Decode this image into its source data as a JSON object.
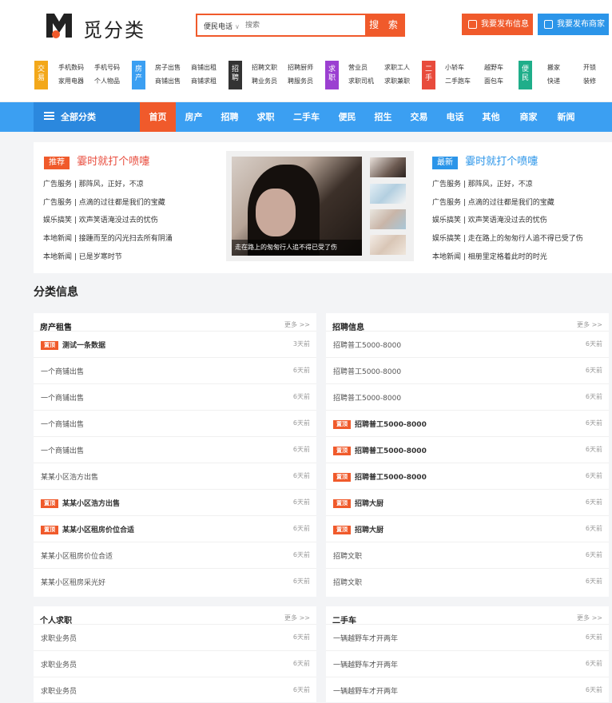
{
  "brand": {
    "name": "觅分类"
  },
  "search": {
    "category": "便民电话",
    "placeholder": "搜索",
    "button": "搜 索"
  },
  "header_buttons": {
    "post_info": "我要发布信息",
    "post_merchant": "我要发布商家"
  },
  "category_groups": [
    {
      "badge": "交易",
      "color": "#f3a81a",
      "items": [
        "手机数码",
        "手机号码",
        "家用电器",
        "个人物品"
      ]
    },
    {
      "badge": "房产",
      "color": "#3b9ff2",
      "items": [
        "房子出售",
        "商铺出租",
        "商铺出售",
        "商铺求租"
      ]
    },
    {
      "badge": "招聘",
      "color": "#333333",
      "items": [
        "招聘文职",
        "招聘厨师",
        "聘业务员",
        "聘服务员"
      ]
    },
    {
      "badge": "求职",
      "color": "#9b3fd1",
      "items": [
        "营业员",
        "求职工人",
        "求职司机",
        "求职兼职"
      ]
    },
    {
      "badge": "二手",
      "color": "#e84b3c",
      "items": [
        "小轿车",
        "越野车",
        "二手跑车",
        "面包车"
      ]
    },
    {
      "badge": "便民",
      "color": "#1fae8a",
      "items": [
        "搬家",
        "开锁",
        "快递",
        "装修"
      ]
    }
  ],
  "nav": {
    "all": "全部分类",
    "items": [
      "首页",
      "房产",
      "招聘",
      "求职",
      "二手车",
      "便民",
      "招生",
      "交易",
      "电话",
      "其他",
      "商家",
      "新闻"
    ]
  },
  "featured_left": {
    "tag": "推荐",
    "title": "霎时就打个喷嚏",
    "lines": [
      "广告服务 | 那阵风，正好，不凉",
      "广告服务 | 点滴的过往都是我们的宝藏",
      "娱乐搞笑 | 欢声笑语淹没过去的忧伤",
      "本地新闻 | 接踵而至的闪光扫去所有阴涌",
      "本地新闻 | 已是岁寒时节"
    ]
  },
  "featured_photo": {
    "caption": "走在路上的匆匆行人追不得已受了伤"
  },
  "featured_right": {
    "tag": "最新",
    "title": "霎时就打个喷嚏",
    "lines": [
      "广告服务 | 那阵风，正好，不凉",
      "广告服务 | 点滴的过往都是我们的宝藏",
      "娱乐搞笑 | 欢声笑语淹没过去的忧伤",
      "娱乐搞笑 | 走在路上的匆匆行人追不得已受了伤",
      "本地新闻 | 相册里定格着此时的时光"
    ]
  },
  "section_title": "分类信息",
  "top_label": "置顶",
  "more_label": "更多 >>",
  "boxes": [
    {
      "title": "房产租售",
      "rows": [
        {
          "text": "测试一条数据",
          "date": "3天前",
          "top": true
        },
        {
          "text": "一个商铺出售",
          "date": "6天前",
          "top": false
        },
        {
          "text": "一个商铺出售",
          "date": "6天前",
          "top": false
        },
        {
          "text": "一个商铺出售",
          "date": "6天前",
          "top": false
        },
        {
          "text": "一个商铺出售",
          "date": "6天前",
          "top": false
        },
        {
          "text": "某某小区浩方出售",
          "date": "6天前",
          "top": false
        },
        {
          "text": "某某小区浩方出售",
          "date": "6天前",
          "top": true
        },
        {
          "text": "某某小区租房价位合适",
          "date": "6天前",
          "top": true
        },
        {
          "text": "某某小区租房价位合适",
          "date": "6天前",
          "top": false
        },
        {
          "text": "某某小区租房采光好",
          "date": "6天前",
          "top": false
        }
      ]
    },
    {
      "title": "招聘信息",
      "rows": [
        {
          "text": "招聘普工5000-8000",
          "date": "6天前",
          "top": false
        },
        {
          "text": "招聘普工5000-8000",
          "date": "6天前",
          "top": false
        },
        {
          "text": "招聘普工5000-8000",
          "date": "6天前",
          "top": false
        },
        {
          "text": "招聘普工5000-8000",
          "date": "6天前",
          "top": true
        },
        {
          "text": "招聘普工5000-8000",
          "date": "6天前",
          "top": true
        },
        {
          "text": "招聘普工5000-8000",
          "date": "6天前",
          "top": true
        },
        {
          "text": "招聘大厨",
          "date": "6天前",
          "top": true
        },
        {
          "text": "招聘大厨",
          "date": "6天前",
          "top": true
        },
        {
          "text": "招聘文职",
          "date": "6天前",
          "top": false
        },
        {
          "text": "招聘文职",
          "date": "6天前",
          "top": false
        }
      ]
    },
    {
      "title": "个人求职",
      "rows": [
        {
          "text": "求职业务员",
          "date": "6天前",
          "top": false
        },
        {
          "text": "求职业务员",
          "date": "6天前",
          "top": false
        },
        {
          "text": "求职业务员",
          "date": "6天前",
          "top": false
        }
      ]
    },
    {
      "title": "二手车",
      "rows": [
        {
          "text": "一辆越野车才开两年",
          "date": "6天前",
          "top": false
        },
        {
          "text": "一辆越野车才开两年",
          "date": "6天前",
          "top": false
        },
        {
          "text": "一辆越野车才开两年",
          "date": "6天前",
          "top": false
        }
      ]
    }
  ]
}
